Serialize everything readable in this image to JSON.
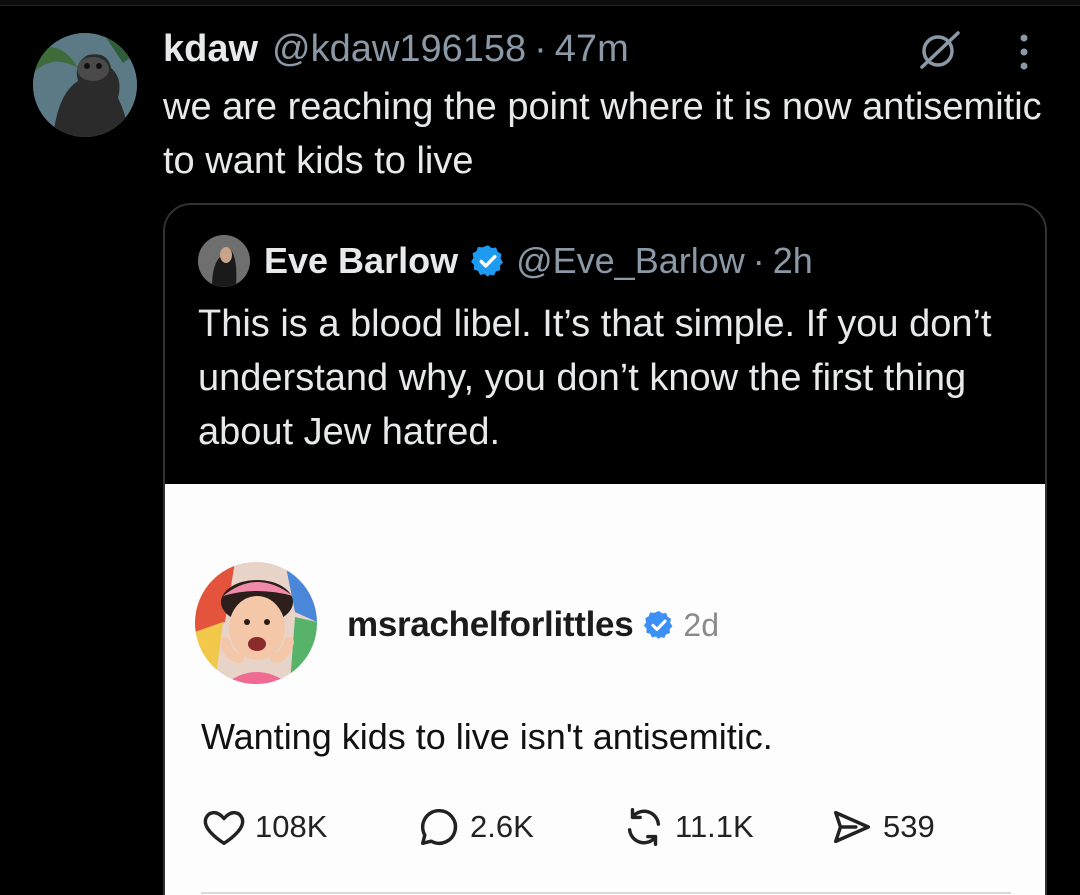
{
  "tweet": {
    "author_name": "kdaw",
    "author_handle": "@kdaw196158",
    "separator": "·",
    "time": "47m",
    "text": "we are reaching the point where it is now antisemitic to want kids to live",
    "icons": [
      "grok-icon",
      "more-icon"
    ]
  },
  "quote": {
    "author_name": "Eve Barlow",
    "verified": true,
    "author_handle": "@Eve_Barlow",
    "separator": "·",
    "time": "2h",
    "text": "This is a blood libel. It’s that simple. If you don’t understand why, you don’t know the first thing about Jew hatred."
  },
  "embedded_post": {
    "username": "msrachelforlittles",
    "verified": true,
    "time": "2d",
    "text": "Wanting kids to live isn't antisemitic.",
    "actions": [
      {
        "icon": "heart-icon",
        "count": "108K"
      },
      {
        "icon": "comment-icon",
        "count": "2.6K"
      },
      {
        "icon": "repost-icon",
        "count": "11.1K"
      },
      {
        "icon": "share-icon",
        "count": "539"
      }
    ]
  },
  "colors": {
    "background": "#000000",
    "text": "#e7e9ea",
    "muted": "#8b98a5",
    "verified": "#1d9bf0",
    "border": "#2f3336"
  }
}
